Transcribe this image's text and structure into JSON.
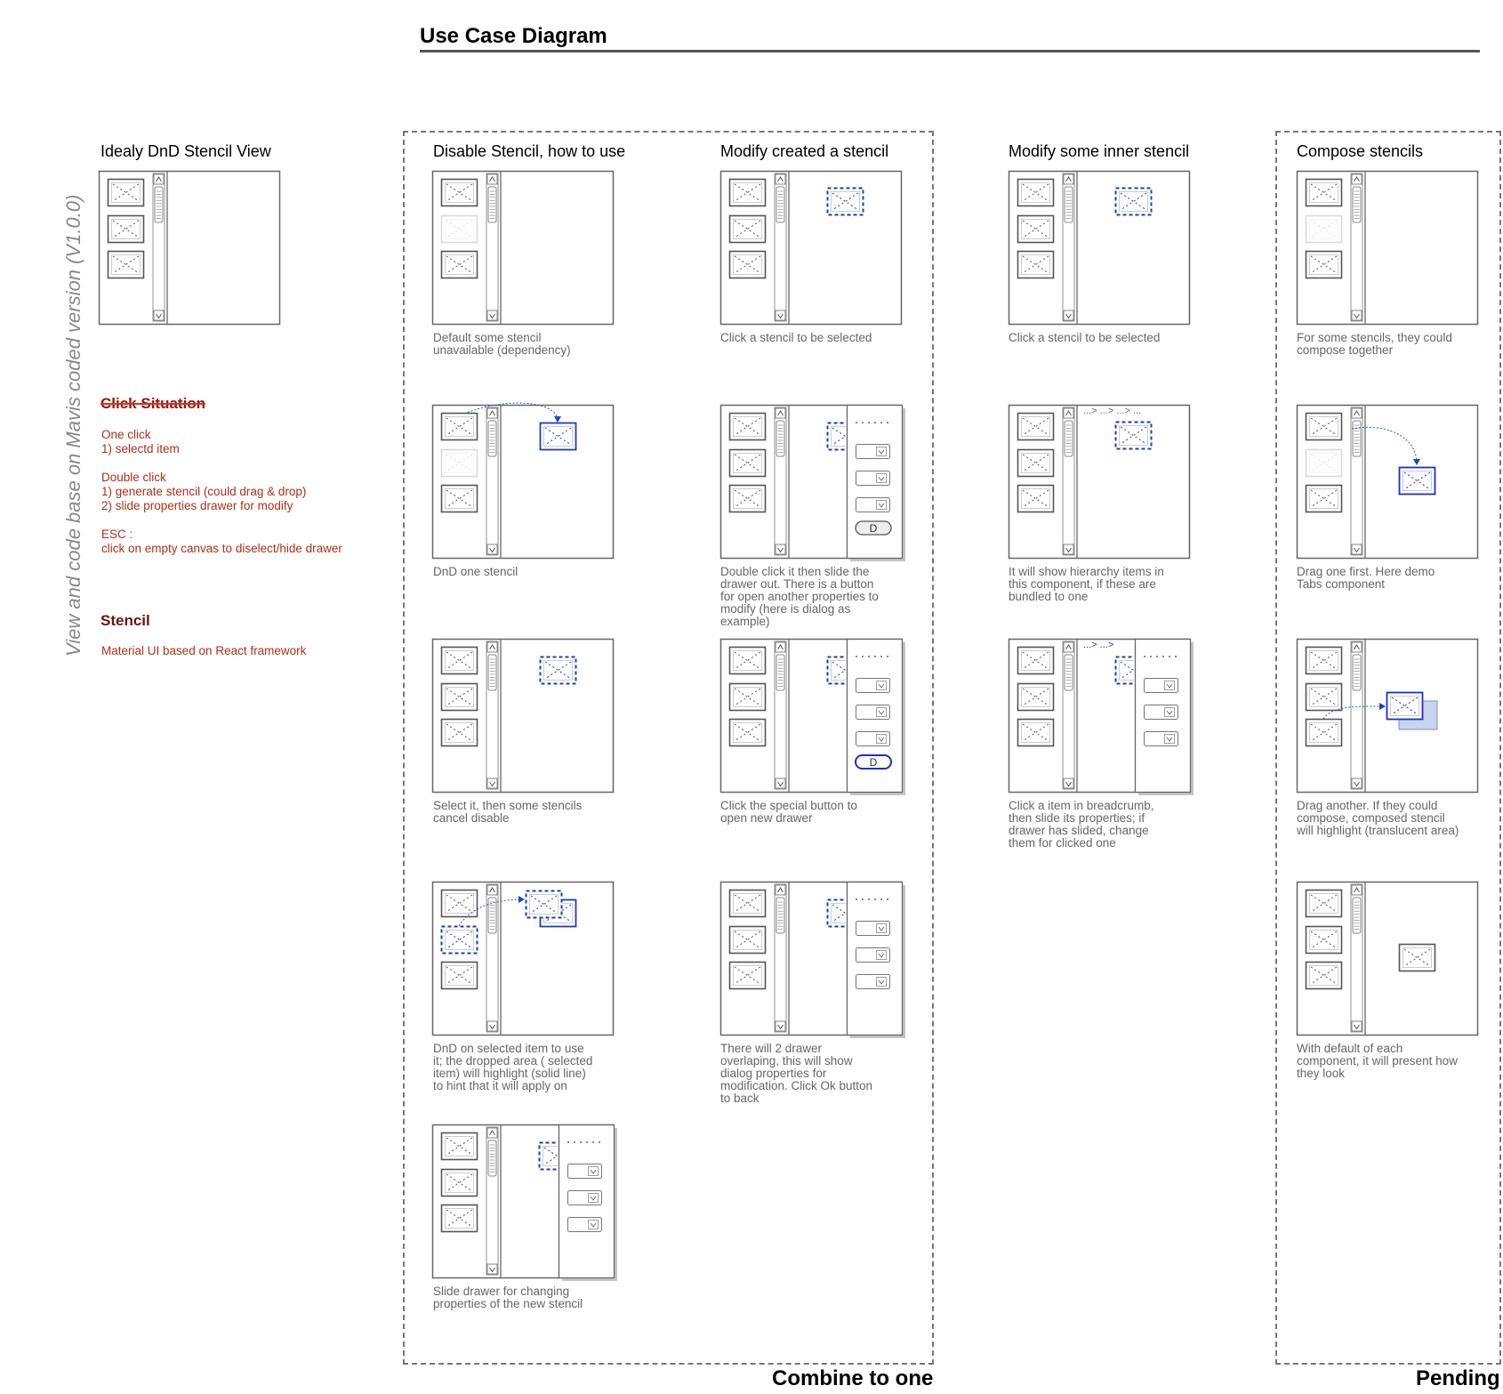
{
  "title": "Use Case Diagram",
  "side_label": "View and code base on Mavis coded version (V1.0.0)",
  "regions": [
    {
      "label": "Combine to one"
    },
    {
      "label": "Pending"
    }
  ],
  "columns": [
    {
      "title": "Idealy DnD Stencil View"
    },
    {
      "title": "Disable Stencil, how to use"
    },
    {
      "title": "Modify created a stencil"
    },
    {
      "title": "Modify some inner stencil"
    },
    {
      "title": "Compose stencils"
    }
  ],
  "notes": {
    "click_heading": "Click Situation",
    "click_lines": [
      "One click",
      "1) selectd item",
      "",
      "Double click",
      "1) generate stencil (could drag & drop)",
      "2) slide properties drawer for modify",
      "",
      "ESC :",
      "click on empty canvas to diselect/hide drawer"
    ],
    "stencil_heading": "Stencil",
    "stencil_text": "Material UI based on React framework"
  },
  "captions": {
    "c2_r1": "Default some stencil\nunavailable (dependency)",
    "c2_r2": "DnD one stencil",
    "c2_r3": "Select it, then some stencils\ncancel disable",
    "c2_r4": "DnD on selected item to use\nit; the dropped area ( selected\nitem) will highlight (solid line)\nto hint that it will apply on",
    "c2_r5": "Slide drawer for changing\nproperties of the new stencil",
    "c3_r1": "Click a stencil to be selected",
    "c3_r2": "Double click it then slide the\ndrawer out. There is a button\nfor open another properties to\nmodify (here is dialog as\nexample)",
    "c3_r3": "Click the special button to\nopen new drawer",
    "c3_r4": "There will 2 drawer\noverlaping, this will show\ndialog properties for\nmodification. Click Ok button\nto back",
    "c4_r1": "Click a stencil to be selected",
    "c4_r2": "It will show hierarchy items in\nthis component, if these are\nbundled to one",
    "c4_r3": "Click a item in breadcrumb,\nthen slide its properties; if\ndrawer has slided, change\nthem for clicked one",
    "c5_r1": "For some stencils, they could\ncompose together",
    "c5_r2": "Drag one first. Here demo\nTabs component",
    "c5_r3": "Drag another. If they could\ncompose, composed stencil\nwill highlight (translucent area)",
    "c5_r4": "With default of each\ncomponent, it will present how\nthey look"
  },
  "drawer_button_label": "D",
  "breadcrumb": {
    "c4_r2": "...> ...> ...> ...",
    "c4_r3": "...> ...>"
  },
  "colors": {
    "panel_border": "#555555",
    "selection_blue": "#1a3fb8",
    "caption_gray": "#666666",
    "note_red": "#b03018",
    "highlight_fill": "#c8d4f0"
  }
}
